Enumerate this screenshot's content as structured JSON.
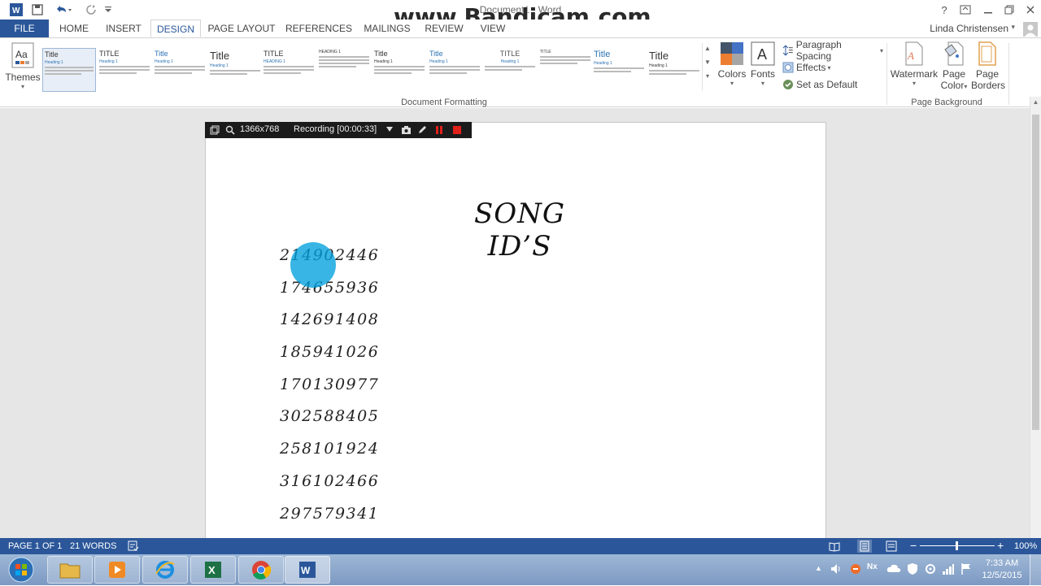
{
  "titlebar": {
    "doc_title": "Document1 - Word",
    "watermark": "www.Bandicam.com",
    "help": "?"
  },
  "tabs": [
    "FILE",
    "HOME",
    "INSERT",
    "DESIGN",
    "PAGE LAYOUT",
    "REFERENCES",
    "MAILINGS",
    "REVIEW",
    "VIEW"
  ],
  "user": "Linda Christensen",
  "ribbon": {
    "themes_label": "Themes",
    "style_titles": [
      "Title",
      "TITLE",
      "Title",
      "Title",
      "TITLE",
      "HEADING 1",
      "Title",
      "Title",
      "TITLE",
      "TITLE",
      "Title",
      "Title"
    ],
    "colors_label": "Colors",
    "fonts_label": "Fonts",
    "paragraph_spacing": "Paragraph Spacing",
    "effects": "Effects",
    "set_default": "Set as Default",
    "document_formatting": "Document Formatting",
    "watermark_label": "Watermark",
    "page_color_line1": "Page",
    "page_color_line2": "Color",
    "page_borders_line1": "Page",
    "page_borders_line2": "Borders",
    "page_background": "Page Background"
  },
  "recorder": {
    "resolution": "1366x768",
    "status": "Recording [00:00:33]"
  },
  "document": {
    "title": "SONG ID’S",
    "song_ids": [
      "214902446",
      "174655936",
      "142691408",
      "185941026",
      "170130977",
      "302588405",
      "258101924",
      "316102466",
      "297579341"
    ]
  },
  "statusbar": {
    "page": "PAGE 1 OF 1",
    "words": "21 WORDS",
    "zoom": "100%"
  },
  "taskbar": {
    "time": "7:33 AM",
    "date": "12/5/2015"
  },
  "colors": {
    "word_blue": "#2b579a",
    "cursor_highlight": "#00a0dc",
    "recorder_red": "#e0201b"
  }
}
